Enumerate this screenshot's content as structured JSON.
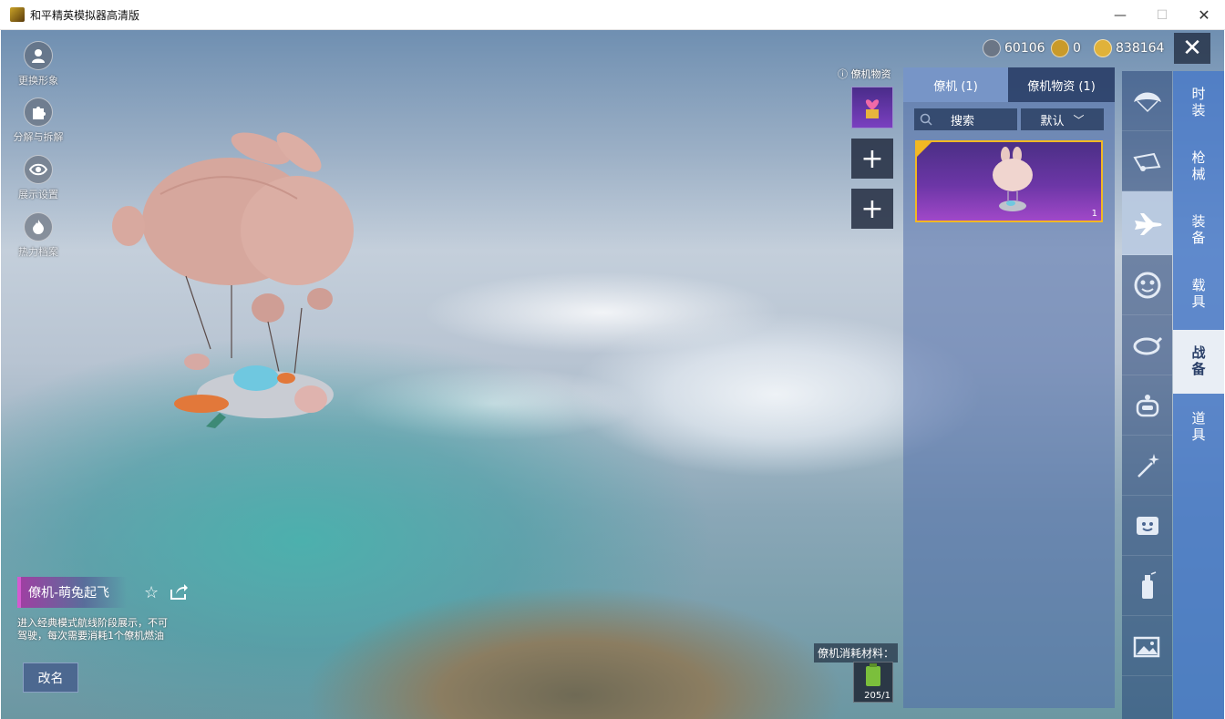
{
  "window": {
    "title": "和平精英模拟器高清版",
    "minimize": "—",
    "maximize": "☐",
    "close": "✕"
  },
  "left_tools": [
    {
      "label": "更换形象",
      "icon": "avatar-icon"
    },
    {
      "label": "分解与拆解",
      "icon": "puzzle-icon"
    },
    {
      "label": "展示设置",
      "icon": "eye-icon"
    },
    {
      "label": "热力档案",
      "icon": "flame-icon"
    }
  ],
  "item": {
    "name": "僚机-萌兔起飞",
    "description": "进入经典模式航线阶段展示，不可驾驶，每次需要消耗1个僚机燃油",
    "rename_label": "改名"
  },
  "currency": [
    {
      "value": "60106",
      "icon": "silver-coin-icon",
      "color": "#6b7686"
    },
    {
      "value": "0",
      "icon": "gold-badge-icon",
      "color": "#c99a2a"
    },
    {
      "value": "838164",
      "icon": "lightning-coin-icon",
      "color": "#e0b23a"
    }
  ],
  "close_panel": "✕",
  "slots": {
    "title": "僚机物资",
    "add_symbol": "+"
  },
  "consume": {
    "label": "僚机消耗材料：",
    "count": "205/1"
  },
  "inventory": {
    "tabs": [
      "僚机 (1)",
      "僚机物资 (1)"
    ],
    "search_placeholder": "搜索",
    "sort_label": "默认",
    "card_count": "1"
  },
  "category_icons": [
    {
      "icon": "parachute-icon"
    },
    {
      "icon": "vehicle-skin-icon"
    },
    {
      "icon": "plane-icon"
    },
    {
      "icon": "face-icon"
    },
    {
      "icon": "pan-icon"
    },
    {
      "icon": "robot-icon"
    },
    {
      "icon": "wand-icon"
    },
    {
      "icon": "emote-icon"
    },
    {
      "icon": "spray-icon"
    },
    {
      "icon": "gallery-icon"
    }
  ],
  "category_tabs": [
    "时装",
    "枪械",
    "装备",
    "载具",
    "战备",
    "道具"
  ]
}
